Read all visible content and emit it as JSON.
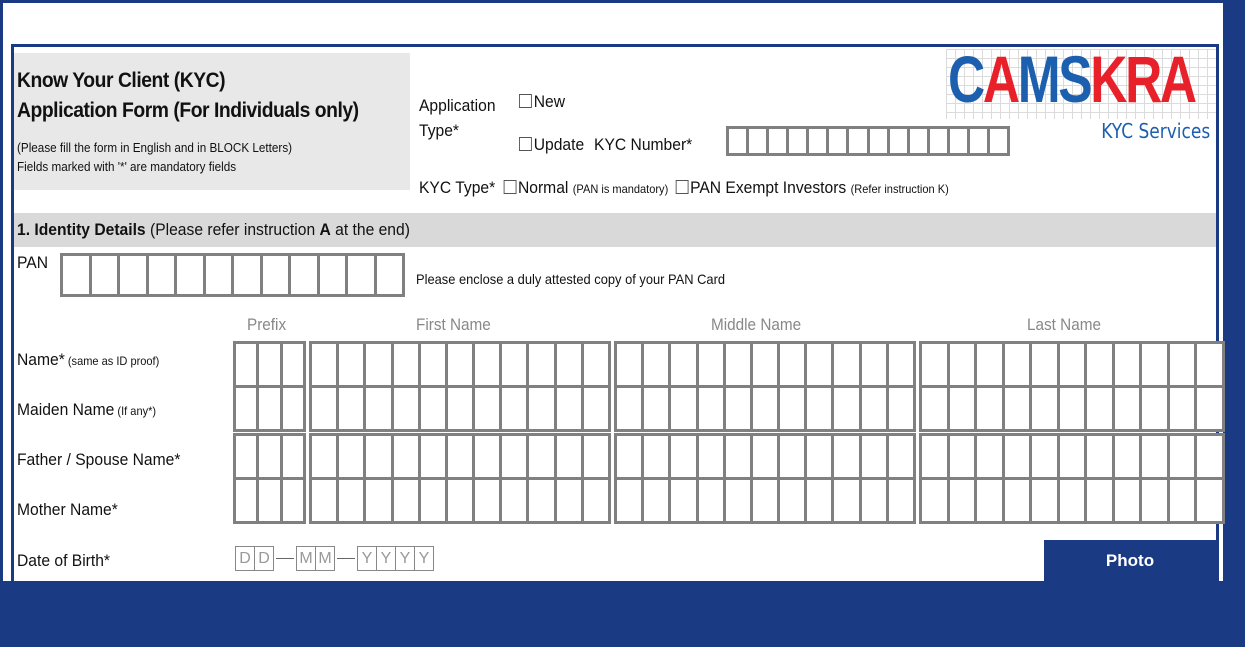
{
  "header": {
    "title_line1": "Know Your Client (KYC)",
    "title_line2": "Application Form (For Individuals only)",
    "note1": "(Please fill the form in English and in BLOCK Letters)",
    "note2": "Fields marked with '*' are mandatory fields"
  },
  "application_type": {
    "label1": "Application",
    "label2": "Type*",
    "options": [
      {
        "label": "New",
        "checked": false
      },
      {
        "label": "Update",
        "checked": false
      }
    ],
    "kyc_number_label": "KYC Number*",
    "kyc_number_boxes": 14
  },
  "kyc_type": {
    "label": "KYC Type*",
    "normal_label": "Normal",
    "normal_note": "(PAN is mandatory)",
    "exempt_label": "PAN Exempt Investors",
    "exempt_note": "(Refer instruction K)"
  },
  "logo": {
    "part_c": "C",
    "part_a": "A",
    "part_ms": "MS",
    "part_kra": "KRA",
    "subtitle": "KYC Services",
    "blue": "#1b5fae",
    "red": "#e8202a"
  },
  "section1": {
    "number_title": "1. Identity Details",
    "pre": " (Please refer instruction ",
    "bold": "A",
    "post": " at the end)"
  },
  "pan": {
    "label": "PAN",
    "boxes": 12,
    "note": "Please enclose a duly attested copy of your PAN Card"
  },
  "name_columns": [
    "Prefix",
    "First Name",
    "Middle Name",
    "Last Name"
  ],
  "name_rows": [
    {
      "label": "Name*",
      "note": " (same as ID proof)"
    },
    {
      "label": "Maiden Name",
      "note": " (If any*)"
    },
    {
      "label": "Father / Spouse Name*",
      "note": ""
    },
    {
      "label": "Mother Name*",
      "note": ""
    }
  ],
  "dob": {
    "label": "Date of Birth*",
    "day": [
      "D",
      "D"
    ],
    "month": [
      "M",
      "M"
    ],
    "year": [
      "Y",
      "Y",
      "Y",
      "Y"
    ]
  },
  "photo": {
    "label": "Photo"
  }
}
